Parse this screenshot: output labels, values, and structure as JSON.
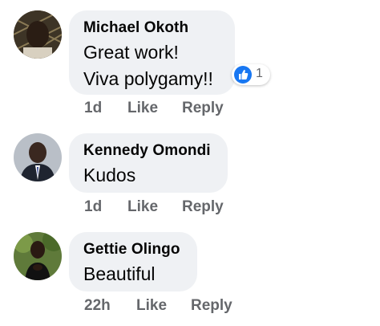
{
  "colors": {
    "bubble": "#eff1f4",
    "text": "#050505",
    "secondary": "#65676b",
    "like_blue": "#1877f2"
  },
  "comments": [
    {
      "author": "Michael Okoth",
      "lines": [
        "Great work!",
        "Viva polygamy!!"
      ],
      "time": "1d",
      "like_label": "Like",
      "reply_label": "Reply",
      "reaction_icon": "thumbs-up-icon",
      "reaction_count": "1"
    },
    {
      "author": "Kennedy Omondi",
      "lines": [
        "Kudos"
      ],
      "time": "1d",
      "like_label": "Like",
      "reply_label": "Reply"
    },
    {
      "author": "Gettie Olingo",
      "lines": [
        "Beautiful"
      ],
      "time": "22h",
      "like_label": "Like",
      "reply_label": "Reply"
    }
  ]
}
